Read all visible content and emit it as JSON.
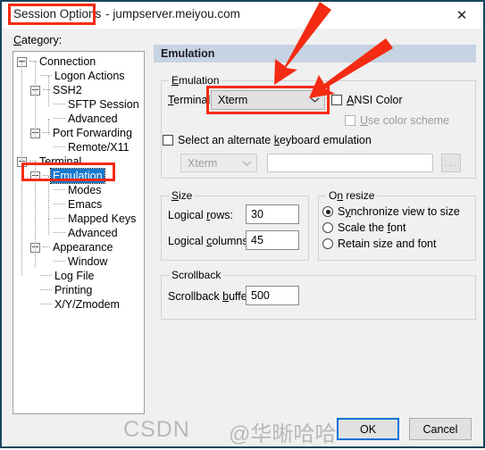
{
  "window": {
    "app_name": "Session Options",
    "separator": " - ",
    "host": "jumpserver.meiyou.com",
    "close_icon": "close-icon",
    "close_glyph": "✕"
  },
  "category": {
    "label": "Category:",
    "label_accel": "C",
    "items": [
      {
        "text": "Connection",
        "depth": 0,
        "expander": "collapse",
        "selected": false
      },
      {
        "text": "Logon Actions",
        "depth": 1,
        "expander": "none",
        "selected": false
      },
      {
        "text": "SSH2",
        "depth": 1,
        "expander": "collapse",
        "selected": false
      },
      {
        "text": "SFTP Session",
        "depth": 2,
        "expander": "none",
        "selected": false
      },
      {
        "text": "Advanced",
        "depth": 2,
        "expander": "none",
        "selected": false
      },
      {
        "text": "Port Forwarding",
        "depth": 1,
        "expander": "collapse",
        "selected": false
      },
      {
        "text": "Remote/X11",
        "depth": 2,
        "expander": "none",
        "selected": false
      },
      {
        "text": "Terminal",
        "depth": 0,
        "expander": "collapse",
        "selected": false
      },
      {
        "text": "Emulation",
        "depth": 1,
        "expander": "collapse",
        "selected": true
      },
      {
        "text": "Modes",
        "depth": 2,
        "expander": "none",
        "selected": false
      },
      {
        "text": "Emacs",
        "depth": 2,
        "expander": "none",
        "selected": false
      },
      {
        "text": "Mapped Keys",
        "depth": 2,
        "expander": "none",
        "selected": false
      },
      {
        "text": "Advanced",
        "depth": 2,
        "expander": "none",
        "selected": false
      },
      {
        "text": "Appearance",
        "depth": 1,
        "expander": "collapse",
        "selected": false
      },
      {
        "text": "Window",
        "depth": 2,
        "expander": "none",
        "selected": false
      },
      {
        "text": "Log File",
        "depth": 1,
        "expander": "none",
        "selected": false
      },
      {
        "text": "Printing",
        "depth": 1,
        "expander": "none",
        "selected": false
      },
      {
        "text": "X/Y/Zmodem",
        "depth": 1,
        "expander": "none",
        "selected": false
      }
    ]
  },
  "panel": {
    "header": "Emulation",
    "emulation_group": {
      "legend": "Emulation",
      "terminal_label": "Terminal:",
      "terminal_value": "Xterm",
      "chevron_glyph": "⌄",
      "ansi_color_label": "ANSI Color",
      "ansi_color_checked": false,
      "use_color_scheme_label": "Use color scheme",
      "use_color_scheme_checked": false,
      "use_color_scheme_enabled": false,
      "alt_keyboard_label": "Select an alternate keyboard emulation",
      "alt_keyboard_checked": false,
      "alt_keyboard_value": "Xterm",
      "alt_keyboard_enabled": false,
      "alt_path_value": "",
      "browse_label": "..."
    },
    "size_group": {
      "legend": "Size",
      "rows_label": "Logical rows:",
      "rows_value": "30",
      "cols_label": "Logical columns:",
      "cols_value": "45"
    },
    "resize_group": {
      "legend": "On resize",
      "options": [
        {
          "label": "Synchronize view to size",
          "selected": true
        },
        {
          "label": "Scale the font",
          "selected": false
        },
        {
          "label": "Retain size and font",
          "selected": false
        }
      ]
    },
    "scrollback_group": {
      "legend": "Scrollback",
      "buffer_label": "Scrollback buffer:",
      "buffer_value": "500"
    }
  },
  "footer": {
    "ok_label": "OK",
    "cancel_label": "Cancel"
  },
  "annotations": {
    "highlight_color": "#f42b13",
    "arrow_color": "#f42b13",
    "boxes": [
      "session-options-title",
      "emulation-tree-item",
      "terminal-dropdown"
    ],
    "arrows": 2
  },
  "watermark": {
    "text_left": "CSDN",
    "text_right": "@华晰哈哈"
  }
}
